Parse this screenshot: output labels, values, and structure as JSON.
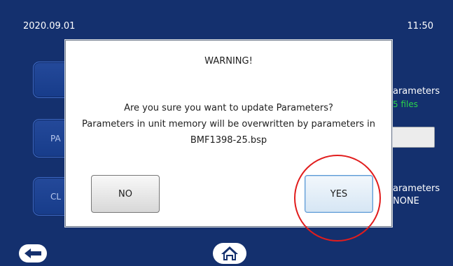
{
  "header": {
    "date": "2020.09.01",
    "time": "11:50"
  },
  "background": {
    "left_buttons": [
      {
        "label": ""
      },
      {
        "label": "PA"
      },
      {
        "label": "CL"
      }
    ],
    "right_panel": {
      "top_title": "arameters",
      "top_subtitle": "5 files",
      "bottom_title": "arameters",
      "bottom_value": "NONE"
    }
  },
  "dialog": {
    "title": "WARNING!",
    "message_lines": [
      "Are you sure you want to update Parameters?",
      "Parameters in unit memory will be overwritten by parameters in",
      "BMF1398-25.bsp"
    ],
    "no_label": "NO",
    "yes_label": "YES"
  },
  "colors": {
    "background": "#14306e",
    "highlight": "#e11d1d",
    "green_text": "#2bd44b"
  },
  "nav": {
    "back_icon": "arrow-left-icon",
    "home_icon": "home-icon"
  }
}
